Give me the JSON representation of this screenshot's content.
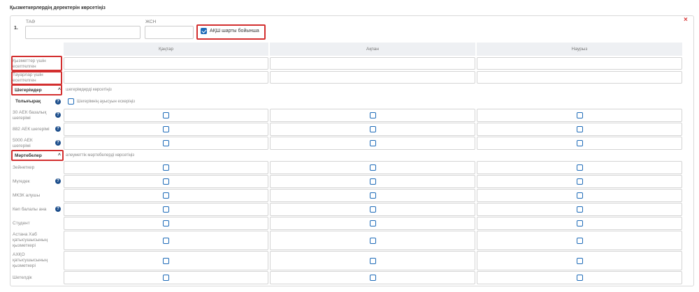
{
  "page": {
    "heading": "Қызметкерлердің деректерін көрсетіңіз",
    "close_symbol": "×"
  },
  "employee": {
    "number": "1.",
    "name_label": "ТАӘ",
    "iin_label": "ЖСН",
    "name_value": "",
    "iin_value": "",
    "akzh_label": "АҚШ шарты бойынша",
    "akzh_checked": true
  },
  "months": [
    "Қаңтар",
    "Ақпан",
    "Наурыз"
  ],
  "income_rows": [
    {
      "label": "Қызметтер үшін есептелген"
    },
    {
      "label": "Тауарлар үшін есептелген"
    }
  ],
  "deductions": {
    "title": "Шегерімдер",
    "hint": "шегерімдерді көрсетіңіз",
    "full_label": "Толығырақ",
    "toggle_label": "Шегерімнің ауысуын ескеріңіз",
    "rows": [
      {
        "label": "30 АЕК базалық шегерімі",
        "help": true
      },
      {
        "label": "882 АЕК шегерімі",
        "help": true
      },
      {
        "label": "5000 АЕК шегерімі",
        "help": true
      }
    ]
  },
  "statuses": {
    "title": "Мәртебелер",
    "hint": "әлеуметтік мәртебелерді көрсетіңіз",
    "rows": [
      {
        "label": "Зейнеткер",
        "help": false
      },
      {
        "label": "Мүгедек",
        "help": true
      },
      {
        "label": "МКЗК алушы",
        "help": false
      },
      {
        "label": "Көп балалы ана",
        "help": true
      },
      {
        "label": "Студент",
        "help": false
      },
      {
        "label": "Астана Хаб қатысушысының қызметкері",
        "help": false
      },
      {
        "label": "АХҚО қатысушысының қызметкері",
        "help": false
      },
      {
        "label": "Шетелдік",
        "help": false
      }
    ]
  },
  "icons": {
    "help": "help-icon",
    "chevron": "chevron-up-icon",
    "close": "close-icon"
  },
  "colors": {
    "accent": "#1e6bb8",
    "highlight": "#d32f2f",
    "close": "#d93a3a"
  }
}
